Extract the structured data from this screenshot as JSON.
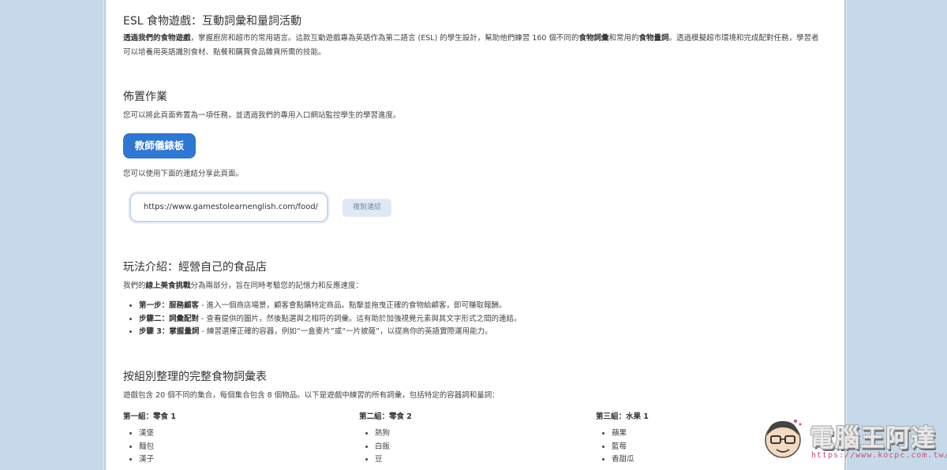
{
  "section1": {
    "title": "ESL 食物遊戲：互動詞彙和量詞活動",
    "intro_bold": "透過我們的食物遊戲",
    "intro_text1": "，掌握廚房和超市的常用語言。這款互動遊戲專為英語作為第二語言 (ESL) 的學生設計，幫助他們練習 160 個不同的",
    "intro_bold2": "食物詞彙",
    "intro_text2": "和常用的",
    "intro_bold3": "食物量詞",
    "intro_text3": "。透過模擬超市環境和完成配對任務，學習者可以培養用英語識別食材、點餐和購買食品雜貨所需的技能。"
  },
  "section2": {
    "title": "佈置作業",
    "text": "您可以將此頁面佈置為一項任務，並透過我們的專用入口網站監控學生的學習進度。",
    "dashboard_button": "教師儀錶板",
    "share_text": "您可以使用下面的連結分享此頁面。",
    "share_url": "https://www.gamestolearnenglish.com/food/",
    "copy_button": "複製連結"
  },
  "section3": {
    "title": "玩法介紹：經營自己的食品店",
    "text_prefix": "我們的",
    "text_bold": "線上美食挑戰",
    "text_suffix": "分為兩部分，旨在同時考驗您的記憶力和反應速度：",
    "steps": [
      {
        "bold": "第一步：服務顧客",
        "text": " - 進入一個商店場景，顧客會點購特定商品。點擊並拖曳正確的食物給顧客，即可賺取報酬。"
      },
      {
        "bold": "步驟二：詞彙配對",
        "text": " - 查看提供的圖片，然後點選與之相符的詞彙。這有助於加強視覺元素與其文字形式之間的連結。"
      },
      {
        "bold": "步驟 3：掌握量詞",
        "text": " - 練習選擇正確的容器，例如“一盒麥片”或“一片披薩”，以提高你的英語實際運用能力。"
      }
    ]
  },
  "section4": {
    "title": "按組別整理的完整食物詞彙表",
    "text": "遊戲包含 20 個不同的集合，每個集合包含 8 個物品。以下是遊戲中練習的所有詞彙，包括特定的容器詞和量詞：",
    "groups": [
      {
        "title": "第一組：零食 1",
        "items": [
          "漢堡",
          "麵包",
          "漢子"
        ]
      },
      {
        "title": "第二組：零食 2",
        "items": [
          "熱狗",
          "白飯",
          "豆"
        ]
      },
      {
        "title": "第三組：水果 1",
        "items": [
          "蘋果",
          "藍莓",
          "香甜瓜"
        ]
      }
    ]
  },
  "watermark": {
    "text": "電腦王阿達",
    "url": "https://www.kocpc.com.tw/"
  },
  "colors": {
    "background": "#c5d9ea",
    "primary_button": "#2f77d5",
    "copy_button_bg": "#dfe9f6",
    "watermark_url": "#d44a6a"
  }
}
